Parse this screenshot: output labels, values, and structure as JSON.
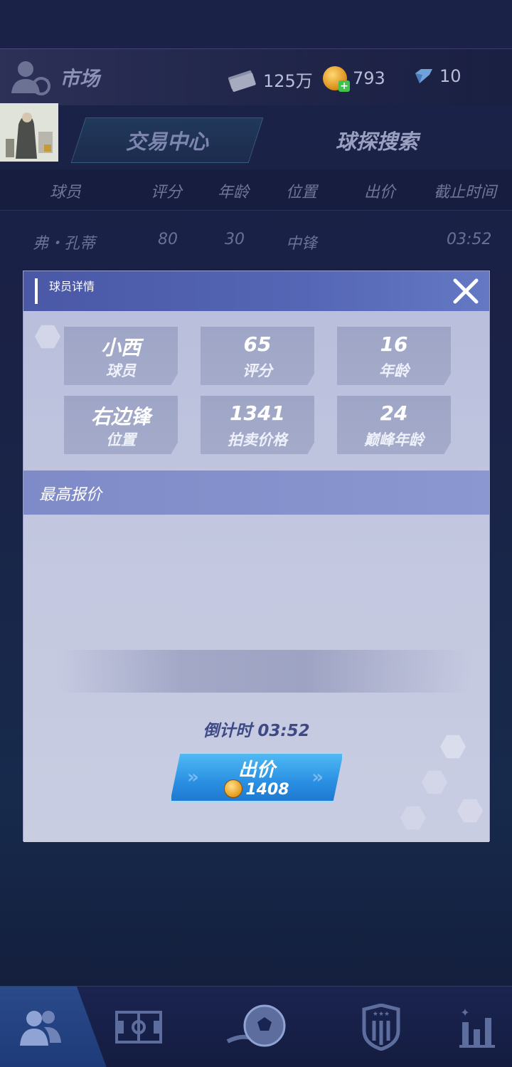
{
  "header": {
    "title": "市场",
    "money": "125万",
    "coins": "793",
    "gems": "10"
  },
  "tabs": [
    {
      "label": "交易中心",
      "active": true
    },
    {
      "label": "球探搜索",
      "active": false
    }
  ],
  "list": {
    "columns": [
      "球员",
      "评分",
      "年龄",
      "位置",
      "出价",
      "截止时间"
    ],
    "rows": [
      {
        "name": "弗・孔蒂",
        "rating": "80",
        "age": "30",
        "position": "中锋",
        "bid": "",
        "deadline": "03:52"
      }
    ]
  },
  "modal": {
    "title": "球员详情",
    "stats": [
      {
        "value": "小西",
        "label": "球员"
      },
      {
        "value": "65",
        "label": "评分"
      },
      {
        "value": "16",
        "label": "年龄"
      },
      {
        "value": "右边锋",
        "label": "位置"
      },
      {
        "value": "1341",
        "label": "拍卖价格"
      },
      {
        "value": "24",
        "label": "巅峰年龄"
      }
    ],
    "section_title": "最高报价",
    "countdown": "倒计时 03:52",
    "bid_button": {
      "label": "出价",
      "price": "1408"
    }
  },
  "nav": {
    "items": [
      "players-icon",
      "pitch-icon",
      "football-icon",
      "club-badge-icon",
      "stats-icon"
    ],
    "active": "players-icon"
  },
  "colors": {
    "accent": "#2a8fe2",
    "modal_header": "#5466b5",
    "coin": "#e59a1c"
  }
}
